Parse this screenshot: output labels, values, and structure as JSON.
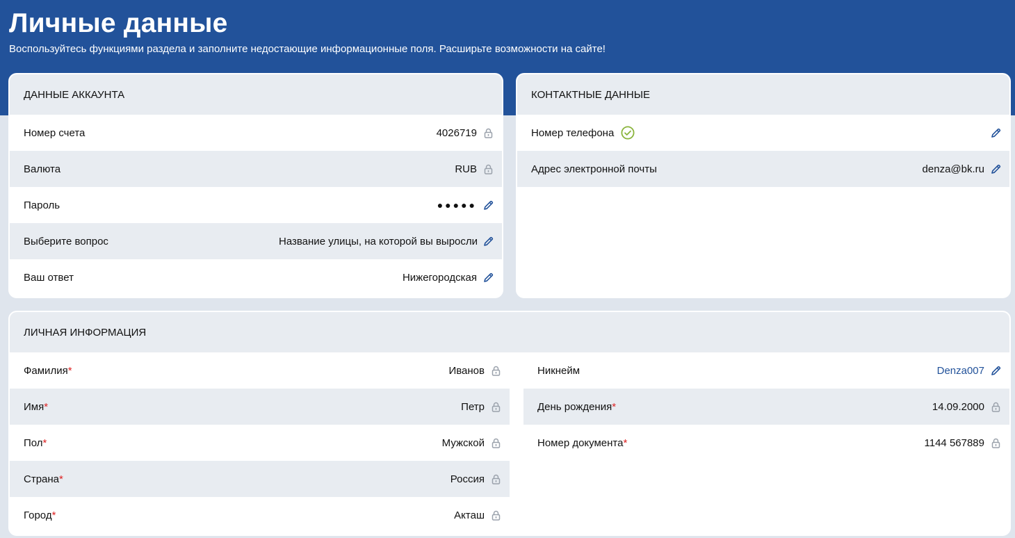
{
  "header": {
    "title": "Личные данные",
    "subtitle": "Воспользуйтесь функциями раздела и заполните недостающие информационные поля. Расширьте возможности на сайте!"
  },
  "account": {
    "heading": "ДАННЫЕ АККАУНТА",
    "rows": [
      {
        "label": "Номер счета",
        "value": "4026719",
        "icon": "lock-icon"
      },
      {
        "label": "Валюта",
        "value": "RUB",
        "icon": "lock-icon"
      },
      {
        "label": "Пароль",
        "value": "●●●●●",
        "icon": "pencil-icon"
      },
      {
        "label": "Выберите вопрос",
        "value": "Название улицы, на которой вы выросли",
        "icon": "pencil-icon"
      },
      {
        "label": "Ваш ответ",
        "value": "Нижегородская",
        "icon": "pencil-icon"
      }
    ]
  },
  "contacts": {
    "heading": "КОНТАКТНЫЕ ДАННЫЕ",
    "rows": [
      {
        "label": "Номер телефона",
        "value": "",
        "icon": "pencil-icon",
        "verified_icon": "check-circle-icon"
      },
      {
        "label": "Адрес электронной почты",
        "value": "denza@bk.ru",
        "icon": "pencil-icon"
      }
    ]
  },
  "personal": {
    "heading": "ЛИЧНАЯ ИНФОРМАЦИЯ",
    "required_mark": "*",
    "left_rows": [
      {
        "label": "Фамилия",
        "value": "Иванов",
        "icon": "lock-icon"
      },
      {
        "label": "Имя",
        "value": "Петр",
        "icon": "lock-icon"
      },
      {
        "label": "Пол",
        "value": "Мужской",
        "icon": "lock-icon"
      },
      {
        "label": "Страна",
        "value": "Россия",
        "icon": "lock-icon"
      },
      {
        "label": "Город",
        "value": "Акташ",
        "icon": "lock-icon"
      }
    ],
    "right_rows": [
      {
        "label": "Никнейм",
        "value": "Denza007",
        "icon": "pencil-icon"
      },
      {
        "label": "День рождения",
        "value": "14.09.2000",
        "icon": "lock-icon"
      },
      {
        "label": "Номер документа",
        "value": "1144 567889",
        "icon": "lock-icon"
      }
    ]
  },
  "colors": {
    "brand_blue": "#22529a",
    "panel_gray": "#e8ecf1",
    "page_bg": "#dfe5ed",
    "required_red": "#dd2222",
    "verified_green": "#8ab43c"
  }
}
